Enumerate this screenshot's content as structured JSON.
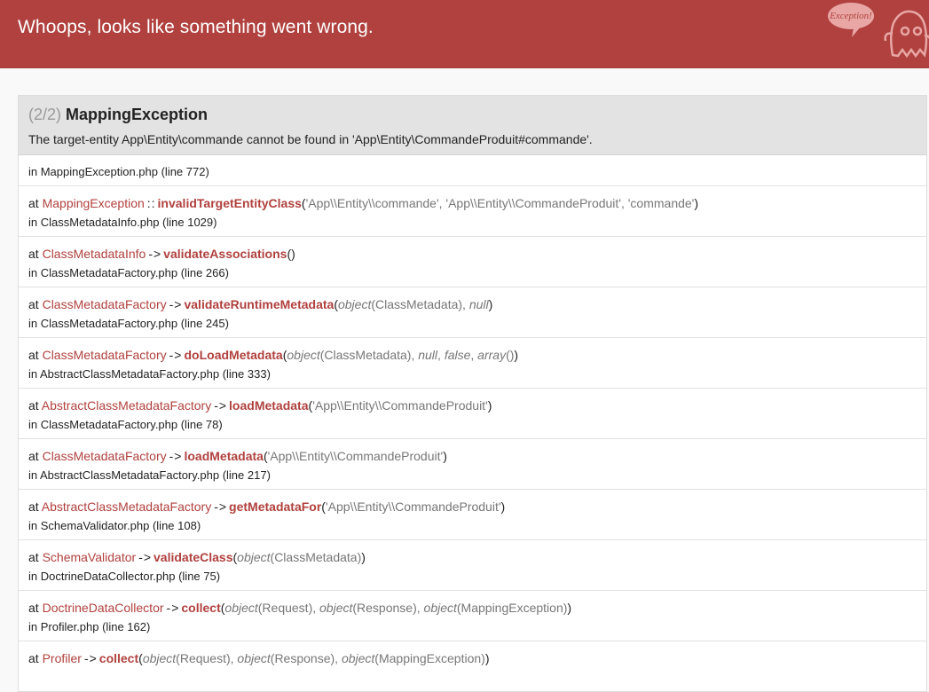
{
  "header": {
    "title": "Whoops, looks like something went wrong.",
    "ghost_text": "Exception!"
  },
  "exception": {
    "count": "(2/2)",
    "name": "MappingException",
    "message": "The target-entity App\\Entity\\commande cannot be found in 'App\\Entity\\CommandeProduit#commande'."
  },
  "first_location": "in MappingException.php (line 772)",
  "frames": [
    {
      "at": "at",
      "cls": "MappingException",
      "sep": "::",
      "fn": "invalidTargetEntityClass",
      "args": "'App\\\\Entity\\\\commande', 'App\\\\Entity\\\\CommandeProduit', 'commande'",
      "loc": "in ClassMetadataInfo.php (line 1029)"
    },
    {
      "at": "at",
      "cls": "ClassMetadataInfo",
      "sep": "->",
      "fn": "validateAssociations",
      "args": "",
      "loc": "in ClassMetadataFactory.php (line 266)"
    },
    {
      "at": "at",
      "cls": "ClassMetadataFactory",
      "sep": "->",
      "fn": "validateRuntimeMetadata",
      "args": "object(ClassMetadata), null",
      "loc": "in ClassMetadataFactory.php (line 245)"
    },
    {
      "at": "at",
      "cls": "ClassMetadataFactory",
      "sep": "->",
      "fn": "doLoadMetadata",
      "args": "object(ClassMetadata), null, false, array()",
      "loc": "in AbstractClassMetadataFactory.php (line 333)"
    },
    {
      "at": "at",
      "cls": "AbstractClassMetadataFactory",
      "sep": "->",
      "fn": "loadMetadata",
      "args": "'App\\\\Entity\\\\CommandeProduit'",
      "loc": "in ClassMetadataFactory.php (line 78)"
    },
    {
      "at": "at",
      "cls": "ClassMetadataFactory",
      "sep": "->",
      "fn": "loadMetadata",
      "args": "'App\\\\Entity\\\\CommandeProduit'",
      "loc": "in AbstractClassMetadataFactory.php (line 217)"
    },
    {
      "at": "at",
      "cls": "AbstractClassMetadataFactory",
      "sep": "->",
      "fn": "getMetadataFor",
      "args": "'App\\\\Entity\\\\CommandeProduit'",
      "loc": "in SchemaValidator.php (line 108)"
    },
    {
      "at": "at",
      "cls": "SchemaValidator",
      "sep": "->",
      "fn": "validateClass",
      "args": "object(ClassMetadata)",
      "loc": "in DoctrineDataCollector.php (line 75)"
    },
    {
      "at": "at",
      "cls": "DoctrineDataCollector",
      "sep": "->",
      "fn": "collect",
      "args": "object(Request), object(Response), object(MappingException)",
      "loc": "in Profiler.php (line 162)"
    },
    {
      "at": "at",
      "cls": "Profiler",
      "sep": "->",
      "fn": "collect",
      "args": "object(Request), object(Response), object(MappingException)",
      "loc": ""
    }
  ],
  "colors": {
    "header_bg": "#b0413e",
    "class_color": "#b0413e",
    "args_color": "#777777"
  }
}
